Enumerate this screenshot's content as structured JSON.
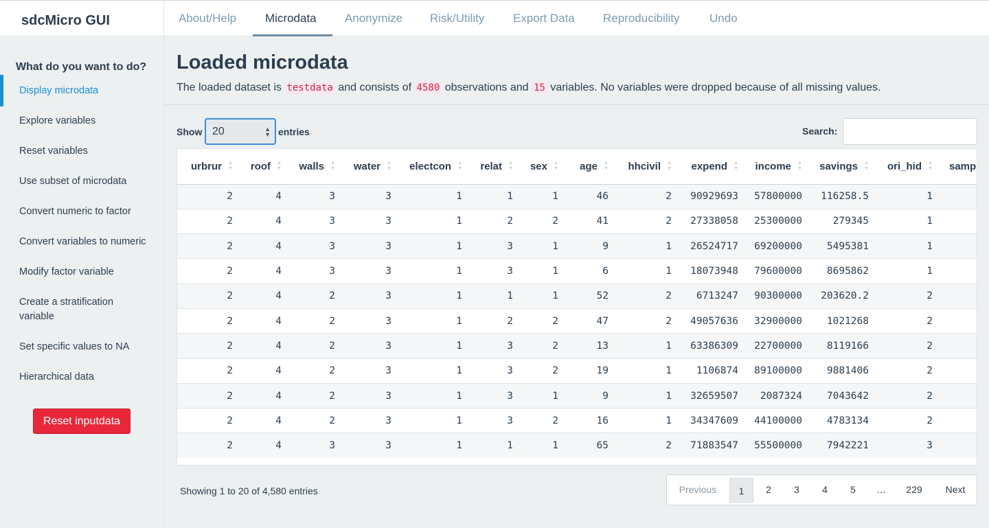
{
  "app": {
    "brand": "sdcMicro GUI"
  },
  "nav": {
    "tabs": [
      {
        "label": "About/Help"
      },
      {
        "label": "Microdata"
      },
      {
        "label": "Anonymize"
      },
      {
        "label": "Risk/Utility"
      },
      {
        "label": "Export Data"
      },
      {
        "label": "Reproducibility"
      },
      {
        "label": "Undo"
      }
    ],
    "active": "Microdata"
  },
  "sidebar": {
    "heading": "What do you want to do?",
    "items": [
      {
        "label": "Display microdata"
      },
      {
        "label": "Explore variables"
      },
      {
        "label": "Reset variables"
      },
      {
        "label": "Use subset of microdata"
      },
      {
        "label": "Convert numeric to factor"
      },
      {
        "label": "Convert variables to numeric"
      },
      {
        "label": "Modify factor variable"
      },
      {
        "label": "Create a stratification variable"
      },
      {
        "label": "Set specific values to NA"
      },
      {
        "label": "Hierarchical data"
      }
    ],
    "reset_button": "Reset inputdata"
  },
  "main": {
    "title": "Loaded microdata",
    "desc_1": "The loaded dataset is",
    "dataset": "testdata",
    "desc_2": "and consists of",
    "obs": "4580",
    "desc_3": "observations and",
    "vars": "15",
    "desc_4": "variables. No variables were dropped because of all missing values."
  },
  "table_controls": {
    "show_label": "Show",
    "length_value": "20",
    "entries_label": "entries",
    "search_label": "Search:",
    "search_value": ""
  },
  "table": {
    "columns": [
      "urbrur",
      "roof",
      "walls",
      "water",
      "electcon",
      "relat",
      "sex",
      "age",
      "hhcivil",
      "expend",
      "income",
      "savings",
      "ori_hid",
      "samplin"
    ],
    "rows": [
      [
        "2",
        "4",
        "3",
        "3",
        "1",
        "1",
        "1",
        "46",
        "2",
        "90929693",
        "57800000",
        "116258.5",
        "1",
        ""
      ],
      [
        "2",
        "4",
        "3",
        "3",
        "1",
        "2",
        "2",
        "41",
        "2",
        "27338058",
        "25300000",
        "279345",
        "1",
        ""
      ],
      [
        "2",
        "4",
        "3",
        "3",
        "1",
        "3",
        "1",
        "9",
        "1",
        "26524717",
        "69200000",
        "5495381",
        "1",
        ""
      ],
      [
        "2",
        "4",
        "3",
        "3",
        "1",
        "3",
        "1",
        "6",
        "1",
        "18073948",
        "79600000",
        "8695862",
        "1",
        ""
      ],
      [
        "2",
        "4",
        "2",
        "3",
        "1",
        "1",
        "1",
        "52",
        "2",
        "6713247",
        "90300000",
        "203620.2",
        "2",
        ""
      ],
      [
        "2",
        "4",
        "2",
        "3",
        "1",
        "2",
        "2",
        "47",
        "2",
        "49057636",
        "32900000",
        "1021268",
        "2",
        ""
      ],
      [
        "2",
        "4",
        "2",
        "3",
        "1",
        "3",
        "2",
        "13",
        "1",
        "63386309",
        "22700000",
        "8119166",
        "2",
        ""
      ],
      [
        "2",
        "4",
        "2",
        "3",
        "1",
        "3",
        "2",
        "19",
        "1",
        "1106874",
        "89100000",
        "9881406",
        "2",
        ""
      ],
      [
        "2",
        "4",
        "2",
        "3",
        "1",
        "3",
        "1",
        "9",
        "1",
        "32659507",
        "2087324",
        "7043642",
        "2",
        ""
      ],
      [
        "2",
        "4",
        "2",
        "3",
        "1",
        "3",
        "2",
        "16",
        "1",
        "34347609",
        "44100000",
        "4783134",
        "2",
        ""
      ],
      [
        "2",
        "4",
        "3",
        "3",
        "1",
        "1",
        "1",
        "65",
        "2",
        "71883547",
        "55500000",
        "7942221",
        "3",
        ""
      ]
    ]
  },
  "footer": {
    "info": "Showing 1 to 20 of 4,580 entries",
    "pager": {
      "previous": "Previous",
      "pages": [
        "1",
        "2",
        "3",
        "4",
        "5",
        "…",
        "229"
      ],
      "next": "Next",
      "current": "1"
    }
  }
}
